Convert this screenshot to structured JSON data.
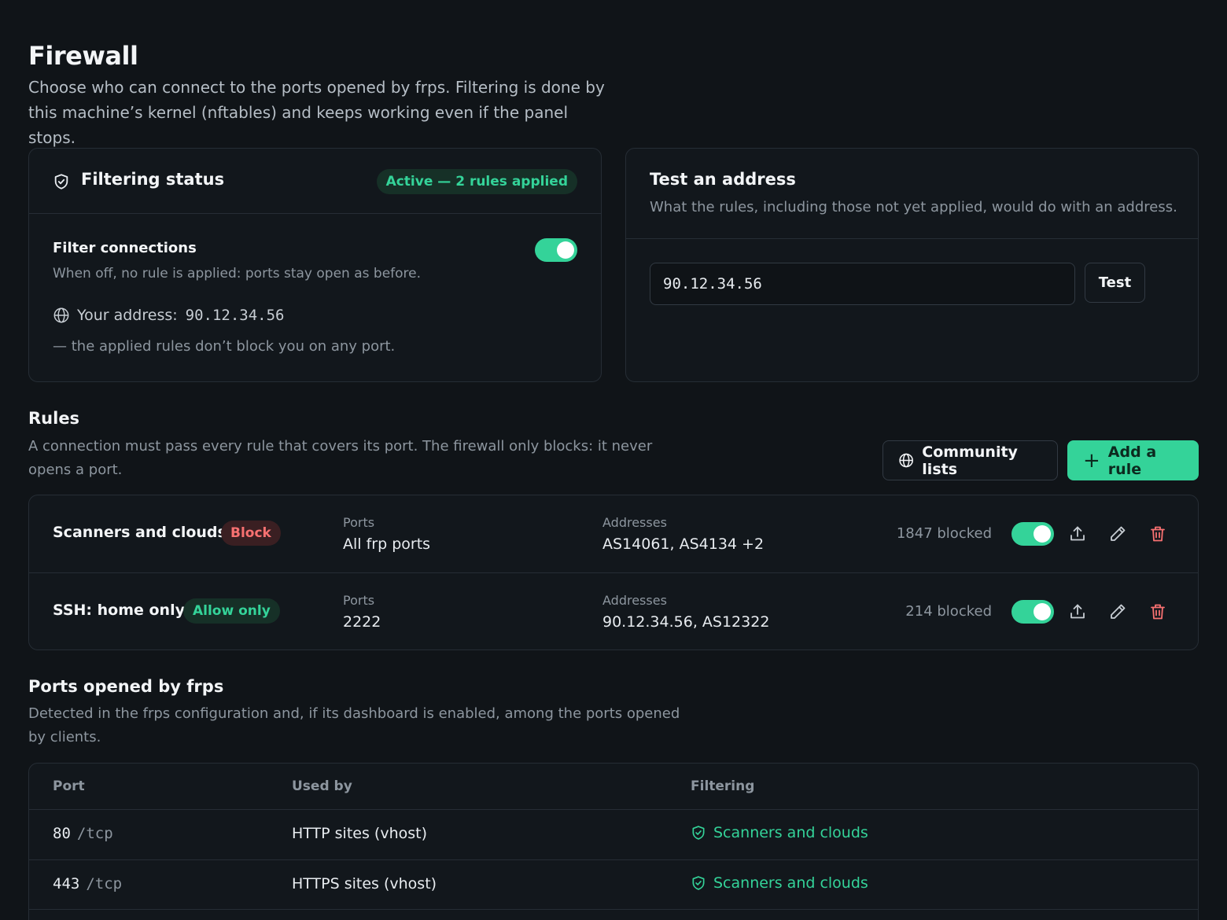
{
  "header": {
    "title": "Firewall",
    "description": "Choose who can connect to the ports opened by frps. Filtering is done by this machine’s kernel (nftables) and keeps working even if the panel stops."
  },
  "status_card": {
    "title": "Filtering status",
    "badge": "Active — 2 rules applied",
    "filter_label": "Filter connections",
    "filter_enabled": true,
    "filter_hint": "When off, no rule is applied: ports stay open as before.",
    "address_label": "Your address:",
    "address_value": "90.12.34.56",
    "address_note": "— the applied rules don’t block you on any port."
  },
  "test_card": {
    "title": "Test an address",
    "description": "What the rules, including those not yet applied, would do with an address.",
    "input_value": "90.12.34.56",
    "button_label": "Test"
  },
  "rules_section": {
    "title": "Rules",
    "description": "A connection must pass every rule that covers its port. The firewall only blocks: it never opens a port.",
    "community_button": "Community lists",
    "add_button": "Add a rule",
    "ports_label": "Ports",
    "addresses_label": "Addresses",
    "rules": [
      {
        "name": "Scanners and clouds",
        "tag": "Block",
        "ports": "All frp ports",
        "addresses": "AS14061, AS4134 +2",
        "blocked": "1847 blocked",
        "enabled": true
      },
      {
        "name": "SSH: home only",
        "tag": "Allow only",
        "ports": "2222",
        "addresses": "90.12.34.56, AS12322",
        "blocked": "214 blocked",
        "enabled": true
      }
    ]
  },
  "ports_section": {
    "title": "Ports opened by frps",
    "description": "Detected in the frps configuration and, if its dashboard is enabled, among the ports opened by clients.",
    "columns": [
      "Port",
      "Used by",
      "Filtering"
    ],
    "rows": [
      {
        "port": "80",
        "proto": "/tcp",
        "used_by": "HTTP sites (vhost)",
        "filtering": "Scanners and clouds"
      },
      {
        "port": "443",
        "proto": "/tcp",
        "used_by": "HTTPS sites (vhost)",
        "filtering": "Scanners and clouds"
      }
    ]
  },
  "colors": {
    "accent": "#34d399",
    "danger": "#f87171",
    "background": "#101418",
    "card": "#12171c"
  },
  "icons": {
    "status": "shield-check-icon",
    "address": "globe-icon",
    "community": "globe-icon",
    "add": "plus-icon",
    "export": "upload-icon",
    "edit": "pencil-icon",
    "delete": "trash-icon",
    "filtering": "shield-check-icon"
  }
}
